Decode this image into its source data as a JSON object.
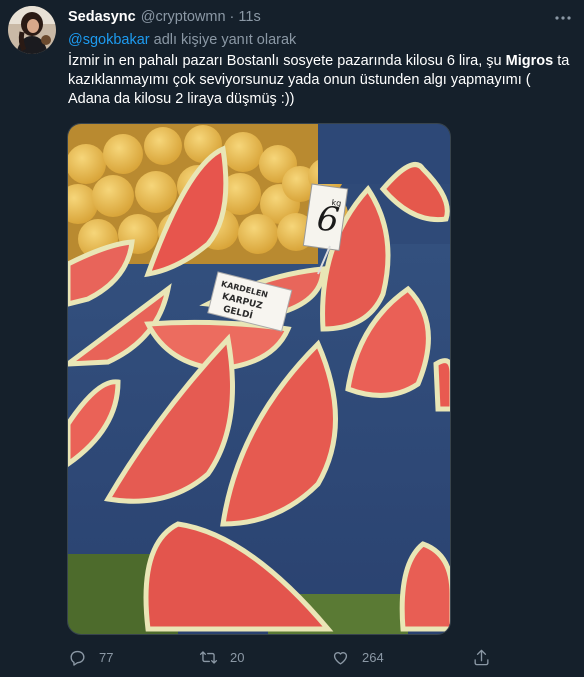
{
  "author": {
    "display_name": "Sedasync",
    "handle": "@cryptowmn",
    "separator": "·",
    "time": "11s"
  },
  "reply_context": {
    "mention": "@sgokbakar",
    "suffix": " adlı kişiye yanıt olarak"
  },
  "tweet": {
    "text_part1": "İzmir in en pahalı pazarı Bostanlı sosyete pazarında kilosu 6 lira, şu ",
    "text_bold": "Migros",
    "text_part2": " ta kazıklanmayımı çok seviyorsunuz yada onun üstunden algı yapmayımı ( Adana da kilosu 2 liraya düşmüş :))"
  },
  "media": {
    "price_sign_text": "6",
    "price_sign_sub": "kg",
    "label_line1": "KARPUZ",
    "label_line2": "GELDİ",
    "label_line0": "KARDELEN"
  },
  "actions": {
    "reply_count": "77",
    "retweet_count": "20",
    "like_count": "264"
  },
  "colors": {
    "background": "#15202b",
    "secondary_text": "#8b98a5",
    "accent": "#1d9bf0"
  }
}
